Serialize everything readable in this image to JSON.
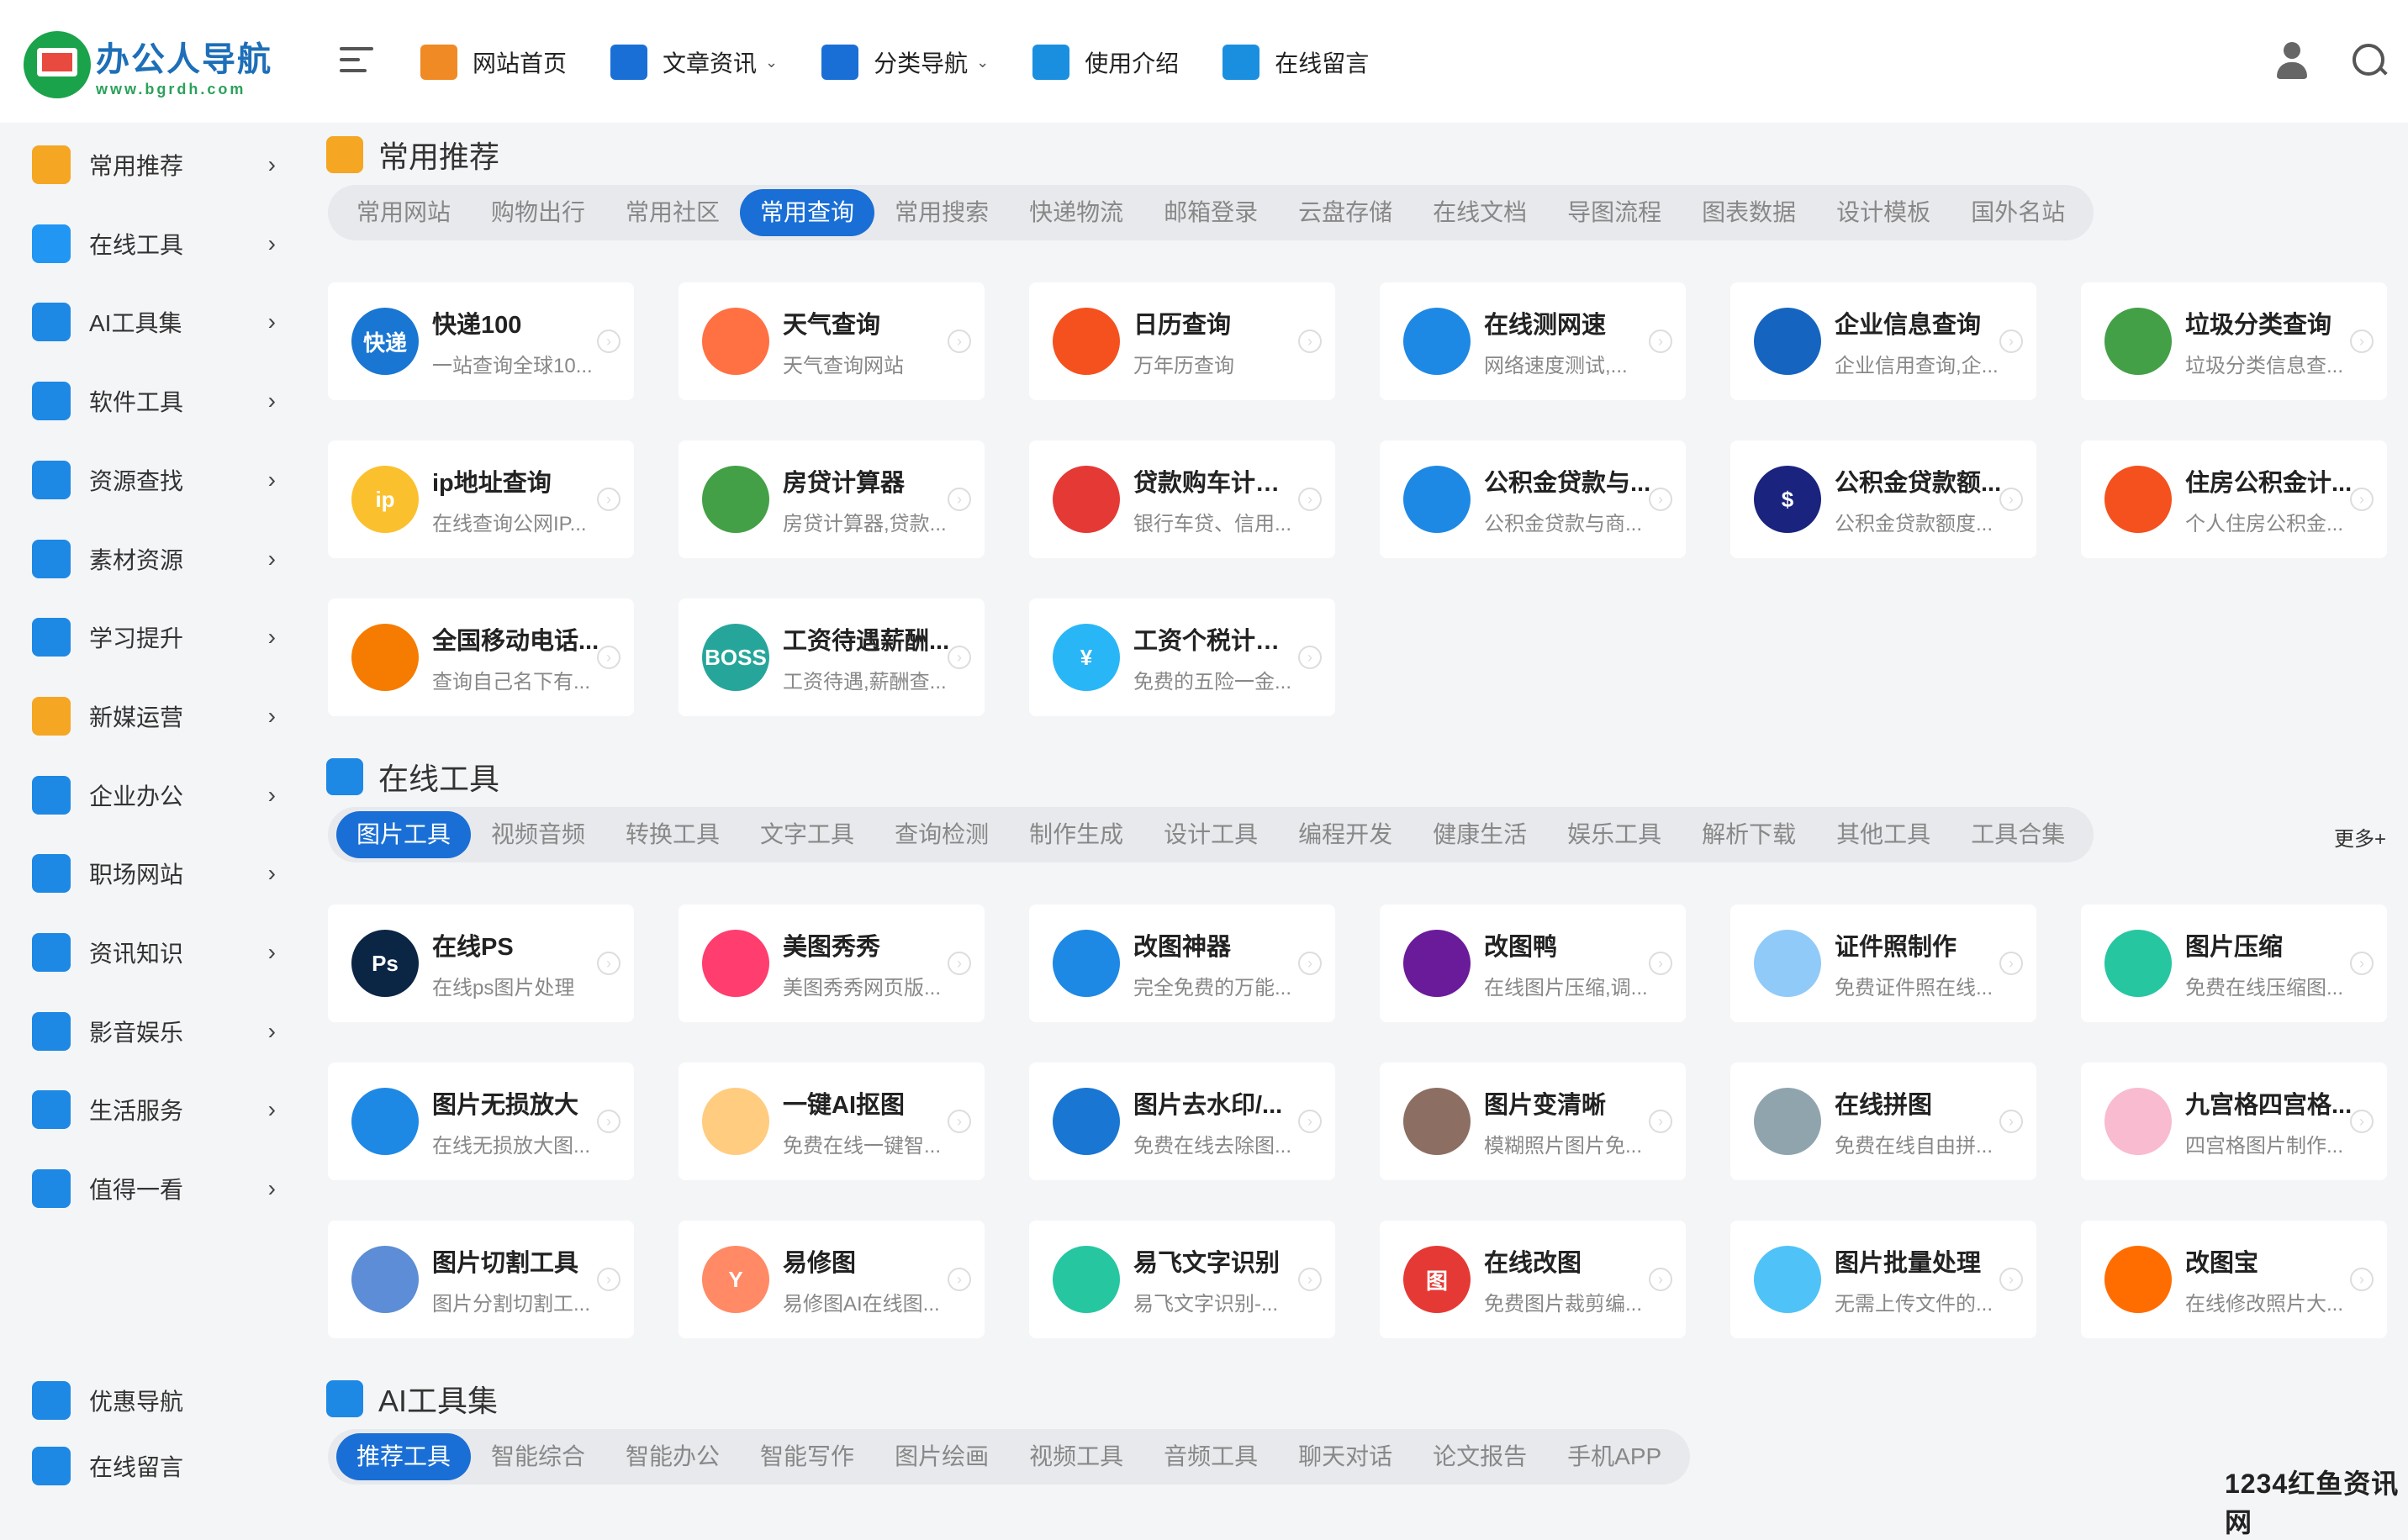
{
  "brand": {
    "title": "办公人导航",
    "url": "www.bgrdh.com"
  },
  "nav": [
    {
      "label": "网站首页",
      "icon": "home-icon",
      "color": "#f08a24",
      "caret": false
    },
    {
      "label": "文章资讯",
      "icon": "article-icon",
      "color": "#1a6fd6",
      "caret": true
    },
    {
      "label": "分类导航",
      "icon": "grid-icon",
      "color": "#1a6fd6",
      "caret": true
    },
    {
      "label": "使用介绍",
      "icon": "heart-icon",
      "color": "#1a8fe0",
      "caret": false
    },
    {
      "label": "在线留言",
      "icon": "message-icon",
      "color": "#1a8fe0",
      "caret": false
    }
  ],
  "sidebar": [
    {
      "label": "常用推荐",
      "icon": "thumbs-up-icon",
      "color": "#f5a623"
    },
    {
      "label": "在线工具",
      "icon": "toolbox-icon",
      "color": "#2196f3"
    },
    {
      "label": "AI工具集",
      "icon": "cube-icon",
      "color": "#1e88e5"
    },
    {
      "label": "软件工具",
      "icon": "monitor-icon",
      "color": "#1e88e5"
    },
    {
      "label": "资源查找",
      "icon": "search-doc-icon",
      "color": "#1e88e5"
    },
    {
      "label": "素材资源",
      "icon": "image-icon",
      "color": "#1e88e5"
    },
    {
      "label": "学习提升",
      "icon": "student-icon",
      "color": "#1e88e5"
    },
    {
      "label": "新媒运营",
      "icon": "pie-chart-icon",
      "color": "#f5a623"
    },
    {
      "label": "企业办公",
      "icon": "office-icon",
      "color": "#1e88e5"
    },
    {
      "label": "职场网站",
      "icon": "users-icon",
      "color": "#1e88e5"
    },
    {
      "label": "资讯知识",
      "icon": "document-icon",
      "color": "#1e88e5"
    },
    {
      "label": "影音娱乐",
      "icon": "video-icon",
      "color": "#1e88e5"
    },
    {
      "label": "生活服务",
      "icon": "person-icon",
      "color": "#1e88e5"
    },
    {
      "label": "值得一看",
      "icon": "windows-icon",
      "color": "#1e88e5"
    }
  ],
  "sidebar_bottom": [
    {
      "label": "优惠导航",
      "icon": "gear-icon",
      "color": "#1e88e5"
    },
    {
      "label": "在线留言",
      "icon": "chat-icon",
      "color": "#1e88e5"
    }
  ],
  "sections": [
    {
      "title": "常用推荐",
      "icon": "thumbs-up-icon",
      "tabs": [
        "常用网站",
        "购物出行",
        "常用社区",
        "常用查询",
        "常用搜索",
        "快递物流",
        "邮箱登录",
        "云盘存储",
        "在线文档",
        "导图流程",
        "图表数据",
        "设计模板",
        "国外名站"
      ],
      "active_tab": 3,
      "more": "",
      "cards": [
        {
          "title": "快递100",
          "desc": "一站查询全球10...",
          "icon": "kuaidi100-icon",
          "color": "#1976d2",
          "glyph": "快递"
        },
        {
          "title": "天气查询",
          "desc": "天气查询网站",
          "icon": "weather-icon",
          "color": "#ff7043",
          "glyph": ""
        },
        {
          "title": "日历查询",
          "desc": "万年历查询",
          "icon": "calendar-icon",
          "color": "#f4511e",
          "glyph": ""
        },
        {
          "title": "在线测网速",
          "desc": "网络速度测试,...",
          "icon": "speedometer-icon",
          "color": "#1e88e5",
          "glyph": ""
        },
        {
          "title": "企业信息查询",
          "desc": "企业信用查询,企...",
          "icon": "enterprise-search-icon",
          "color": "#1565c0",
          "glyph": ""
        },
        {
          "title": "垃圾分类查询",
          "desc": "垃圾分类信息查...",
          "icon": "recycle-bin-icon",
          "color": "#43a047",
          "glyph": ""
        },
        {
          "title": "ip地址查询",
          "desc": "在线查询公网IP...",
          "icon": "ip-icon",
          "color": "#fbc02d",
          "glyph": "ip"
        },
        {
          "title": "房贷计算器",
          "desc": "房贷计算器,贷款...",
          "icon": "mortgage-calculator-icon",
          "color": "#43a047",
          "glyph": ""
        },
        {
          "title": "贷款购车计算器",
          "desc": "银行车贷、信用...",
          "icon": "car-loan-icon",
          "color": "#e53935",
          "glyph": ""
        },
        {
          "title": "公积金贷款与...",
          "desc": "公积金贷款与商...",
          "icon": "fund-loan-icon",
          "color": "#1e88e5",
          "glyph": ""
        },
        {
          "title": "公积金贷款额...",
          "desc": "公积金贷款额度...",
          "icon": "fund-amount-icon",
          "color": "#1a237e",
          "glyph": "$"
        },
        {
          "title": "住房公积金计...",
          "desc": "个人住房公积金...",
          "icon": "housing-fund-icon",
          "color": "#f4511e",
          "glyph": ""
        },
        {
          "title": "全国移动电话...",
          "desc": "查询自己名下有...",
          "icon": "phone-check-icon",
          "color": "#f57c00",
          "glyph": ""
        },
        {
          "title": "工资待遇薪酬...",
          "desc": "工资待遇,薪酬查...",
          "icon": "boss-icon",
          "color": "#26a69a",
          "glyph": "BOSS"
        },
        {
          "title": "工资个税计算器",
          "desc": "免费的五险一金...",
          "icon": "tax-calculator-icon",
          "color": "#29b6f6",
          "glyph": "¥"
        }
      ]
    },
    {
      "title": "在线工具",
      "icon": "toolbox-icon",
      "tabs": [
        "图片工具",
        "视频音频",
        "转换工具",
        "文字工具",
        "查询检测",
        "制作生成",
        "设计工具",
        "编程开发",
        "健康生活",
        "娱乐工具",
        "解析下载",
        "其他工具",
        "工具合集"
      ],
      "active_tab": 0,
      "more": "更多+",
      "cards": [
        {
          "title": "在线PS",
          "desc": "在线ps图片处理",
          "icon": "photoshop-icon",
          "color": "#0b2545",
          "glyph": "Ps"
        },
        {
          "title": "美图秀秀",
          "desc": "美图秀秀网页版...",
          "icon": "meitu-icon",
          "color": "#ff3d6e",
          "glyph": ""
        },
        {
          "title": "改图神器",
          "desc": "完全免费的万能...",
          "icon": "ghost-icon",
          "color": "#1e88e5",
          "glyph": ""
        },
        {
          "title": "改图鸭",
          "desc": "在线图片压缩,调...",
          "icon": "picture-frame-icon",
          "color": "#6a1b9a",
          "glyph": ""
        },
        {
          "title": "证件照制作",
          "desc": "免费证件照在线...",
          "icon": "id-photo-icon",
          "color": "#90caf9",
          "glyph": ""
        },
        {
          "title": "图片压缩",
          "desc": "免费在线压缩图...",
          "icon": "image-compress-icon",
          "color": "#26c6a1",
          "glyph": ""
        },
        {
          "title": "图片无损放大",
          "desc": "在线无损放大图...",
          "icon": "doraemon-icon",
          "color": "#1e88e5",
          "glyph": ""
        },
        {
          "title": "一键AI抠图",
          "desc": "免费在线一键智...",
          "icon": "cutout-icon",
          "color": "#ffcc80",
          "glyph": ""
        },
        {
          "title": "图片去水印/...",
          "desc": "免费在线去除图...",
          "icon": "stamp-icon",
          "color": "#1976d2",
          "glyph": ""
        },
        {
          "title": "图片变清晰",
          "desc": "模糊照片图片免...",
          "icon": "portrait-icon",
          "color": "#8d6e63",
          "glyph": ""
        },
        {
          "title": "在线拼图",
          "desc": "免费在线自由拼...",
          "icon": "collage-icon",
          "color": "#90a4ae",
          "glyph": ""
        },
        {
          "title": "九宫格四宫格...",
          "desc": "四宫格图片制作...",
          "icon": "grid-photo-icon",
          "color": "#f8bbd0",
          "glyph": ""
        },
        {
          "title": "图片切割工具",
          "desc": "图片分割切割工...",
          "icon": "mountain-icon",
          "color": "#5c8dd6",
          "glyph": ""
        },
        {
          "title": "易修图",
          "desc": "易修图AI在线图...",
          "icon": "yixiutu-icon",
          "color": "#ff8a65",
          "glyph": "Y"
        },
        {
          "title": "易飞文字识别",
          "desc": "易飞文字识别-...",
          "icon": "ocr-icon",
          "color": "#26c6a1",
          "glyph": ""
        },
        {
          "title": "在线改图",
          "desc": "免费图片裁剪编...",
          "icon": "tu-icon",
          "color": "#e53935",
          "glyph": "图"
        },
        {
          "title": "图片批量处理",
          "desc": "无需上传文件的...",
          "icon": "batch-recycle-icon",
          "color": "#4fc3f7",
          "glyph": ""
        },
        {
          "title": "改图宝",
          "desc": "在线修改照片大...",
          "icon": "gaitubao-icon",
          "color": "#ff6d00",
          "glyph": ""
        }
      ]
    },
    {
      "title": "AI工具集",
      "icon": "cube-icon",
      "tabs": [
        "推荐工具",
        "智能综合",
        "智能办公",
        "智能写作",
        "图片绘画",
        "视频工具",
        "音频工具",
        "聊天对话",
        "论文报告",
        "手机APP"
      ],
      "active_tab": 0,
      "more": "",
      "cards": []
    }
  ],
  "watermark": "1234红鱼资讯网"
}
